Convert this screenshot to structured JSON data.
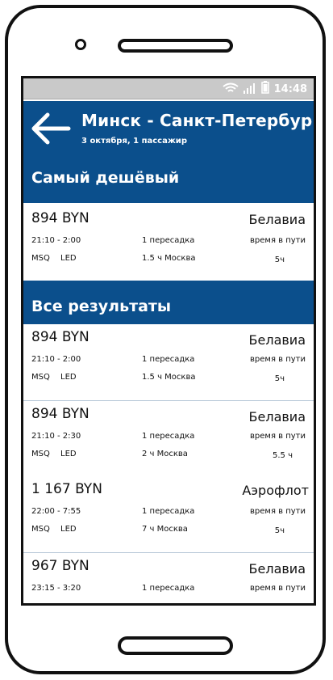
{
  "status_bar": {
    "time": "14:48"
  },
  "header": {
    "title": "Минск - Санкт-Петербург",
    "subtitle": "3 октября, 1 пассажир"
  },
  "cheapest": {
    "section_title": "Самый дешёвый",
    "flight": {
      "price": "894 BYN",
      "airline": "Белавиа",
      "times": "21:10  -  2:00",
      "airports": "MSQ  LED",
      "transfers": "1 пересадка",
      "layover": "1.5 ч Москва",
      "duration_label": "время в пути",
      "duration": "5ч"
    }
  },
  "all_results": {
    "section_title": "Все результаты",
    "flights": [
      {
        "price": "894 BYN",
        "airline": "Белавиа",
        "times": "21:10  -  2:00",
        "airports": "MSQ  LED",
        "transfers": "1 пересадка",
        "layover": "1.5 ч Москва",
        "duration_label": "время в пути",
        "duration": "5ч"
      },
      {
        "price": "894 BYN",
        "airline": "Белавиа",
        "times": "21:10  -  2:30",
        "airports": "MSQ  LED",
        "transfers": "1 пересадка",
        "layover": "2 ч Москва",
        "duration_label": "время в пути",
        "duration": "5.5 ч"
      },
      {
        "price": "1 167 BYN",
        "airline": "Аэрофлот",
        "times": "22:00  -  7:55",
        "airports": "MSQ  LED",
        "transfers": "1 пересадка",
        "layover": "7 ч Москва",
        "duration_label": "время в пути",
        "duration": "5ч"
      },
      {
        "price": "967 BYN",
        "airline": "Белавиа",
        "times": "23:15  -  3:20",
        "transfers": "1 пересадка",
        "duration_label": "время в пути"
      }
    ]
  },
  "icons": {
    "back": "arrow-left-icon",
    "wifi": "wifi-icon",
    "signal": "signal-icon",
    "battery": "battery-icon"
  },
  "colors": {
    "header_blue": "#0b4f8c",
    "status_bar_gray": "#c9c9c9"
  }
}
